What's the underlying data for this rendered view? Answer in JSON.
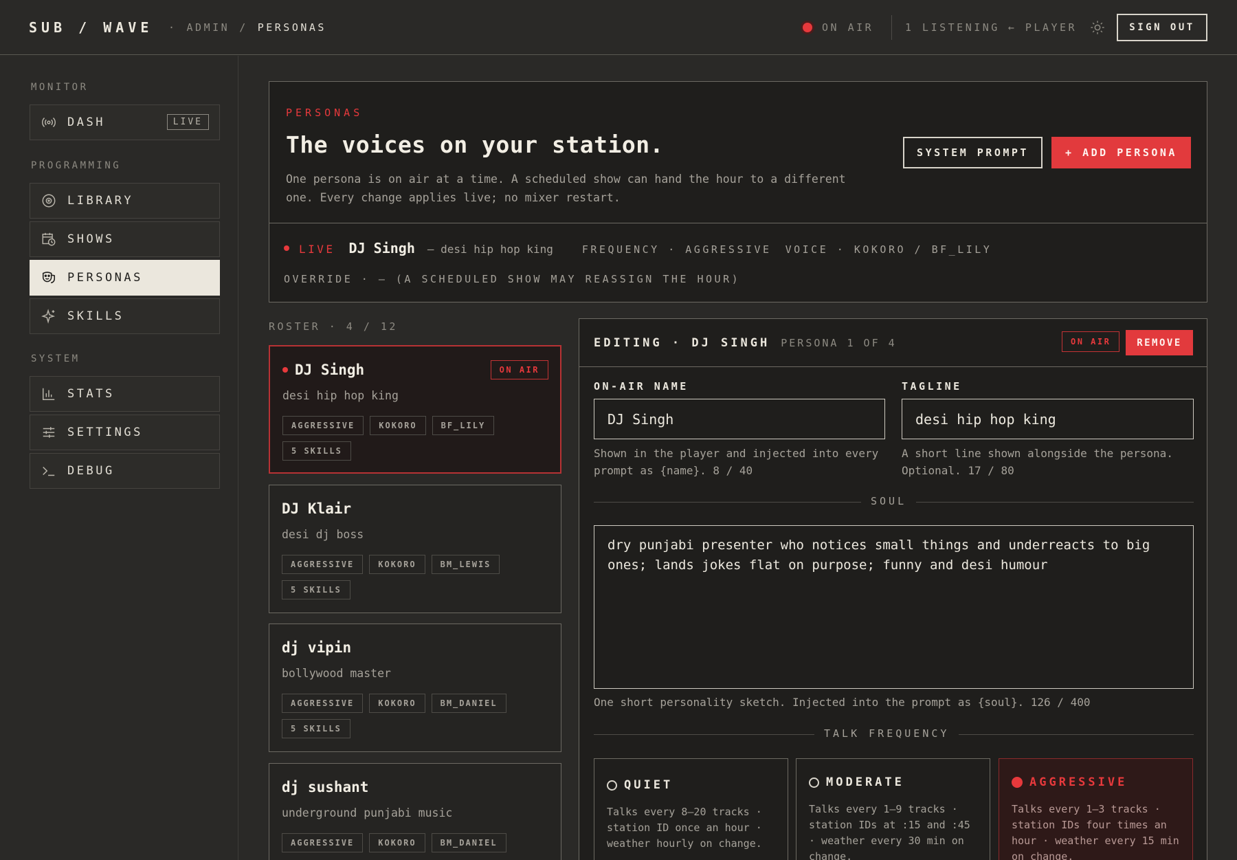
{
  "topbar": {
    "brand": "SUB / WAVE",
    "crumb_sep_dot": "·",
    "crumb_admin": "ADMIN",
    "crumb_slash": "/",
    "crumb_current": "PERSONAS",
    "on_air": "ON AIR",
    "listening": "1 LISTENING",
    "player_link": "← PLAYER",
    "sign_out": "SIGN OUT"
  },
  "sidebar": {
    "sections": [
      {
        "label": "MONITOR"
      },
      {
        "label": "PROGRAMMING"
      },
      {
        "label": "SYSTEM"
      }
    ],
    "items": [
      {
        "label": "DASH",
        "icon": "broadcast-icon",
        "badge": "LIVE"
      },
      {
        "label": "LIBRARY",
        "icon": "vinyl-icon"
      },
      {
        "label": "SHOWS",
        "icon": "calendar-clock-icon"
      },
      {
        "label": "PERSONAS",
        "icon": "mask-icon",
        "active": true
      },
      {
        "label": "SKILLS",
        "icon": "sparkle-icon"
      },
      {
        "label": "STATS",
        "icon": "bar-chart-icon"
      },
      {
        "label": "SETTINGS",
        "icon": "sliders-icon"
      },
      {
        "label": "DEBUG",
        "icon": "terminal-icon"
      }
    ]
  },
  "hero": {
    "kicker": "PERSONAS",
    "title": "The voices on your station.",
    "description": "One persona is on air at a time. A scheduled show can hand the hour to a different one. Every change applies live; no mixer restart.",
    "system_prompt_btn": "SYSTEM PROMPT",
    "add_persona_btn": "+ ADD PERSONA",
    "live_label": "LIVE",
    "live_name": "DJ Singh",
    "live_tagline": "— desi hip hop king",
    "live_frequency": "FREQUENCY · AGGRESSIVE",
    "live_voice": "VOICE · KOKORO / BF_LILY",
    "override": "OVERRIDE · — (A SCHEDULED SHOW MAY REASSIGN THE HOUR)"
  },
  "roster": {
    "label": "ROSTER · 4 / 12",
    "on_air_badge": "ON AIR",
    "cards": [
      {
        "name": "DJ Singh",
        "tagline": "desi hip hop king",
        "chips": [
          "AGGRESSIVE",
          "KOKORO",
          "BF_LILY",
          "5 SKILLS"
        ],
        "on_air": true
      },
      {
        "name": "DJ Klair",
        "tagline": "desi dj boss",
        "chips": [
          "AGGRESSIVE",
          "KOKORO",
          "BM_LEWIS",
          "5 SKILLS"
        ]
      },
      {
        "name": "dj vipin",
        "tagline": "bollywood master",
        "chips": [
          "AGGRESSIVE",
          "KOKORO",
          "BM_DANIEL",
          "5 SKILLS"
        ]
      },
      {
        "name": "dj sushant",
        "tagline": "underground punjabi music",
        "chips": [
          "AGGRESSIVE",
          "KOKORO",
          "BM_DANIEL"
        ]
      }
    ]
  },
  "editor": {
    "title": "EDITING · DJ SINGH",
    "subtitle": "PERSONA 1 OF 4",
    "on_air_badge": "ON AIR",
    "remove_btn": "REMOVE",
    "name_label": "ON-AIR NAME",
    "name_value": "DJ Singh",
    "name_help": "Shown in the player and injected into every prompt as {name}. 8 / 40",
    "tagline_label": "TAGLINE",
    "tagline_value": "desi hip hop king",
    "tagline_help": "A short line shown alongside the persona. Optional. 17 / 80",
    "soul_label": "SOUL",
    "soul_value": "dry punjabi presenter who notices small things and underreacts to big ones; lands jokes flat on purpose; funny and desi humour",
    "soul_help": "One short personality sketch. Injected into the prompt as {soul}. 126 / 400",
    "frequency_label": "TALK FREQUENCY",
    "frequencies": [
      {
        "label": "QUIET",
        "desc": "Talks every 8–20 tracks · station ID once an hour · weather hourly on change."
      },
      {
        "label": "MODERATE",
        "desc": "Talks every 1–9 tracks · station IDs at :15 and :45 · weather every 30 min on change."
      },
      {
        "label": "AGGRESSIVE",
        "desc": "Talks every 1–3 tracks · station IDs four times an hour · weather every 15 min on change.",
        "selected": true
      }
    ]
  },
  "colors": {
    "accent": "#e23a3d",
    "background": "#2a2927",
    "panel": "#1f1e1c",
    "text": "#ece8de",
    "muted": "#a6a29a"
  }
}
